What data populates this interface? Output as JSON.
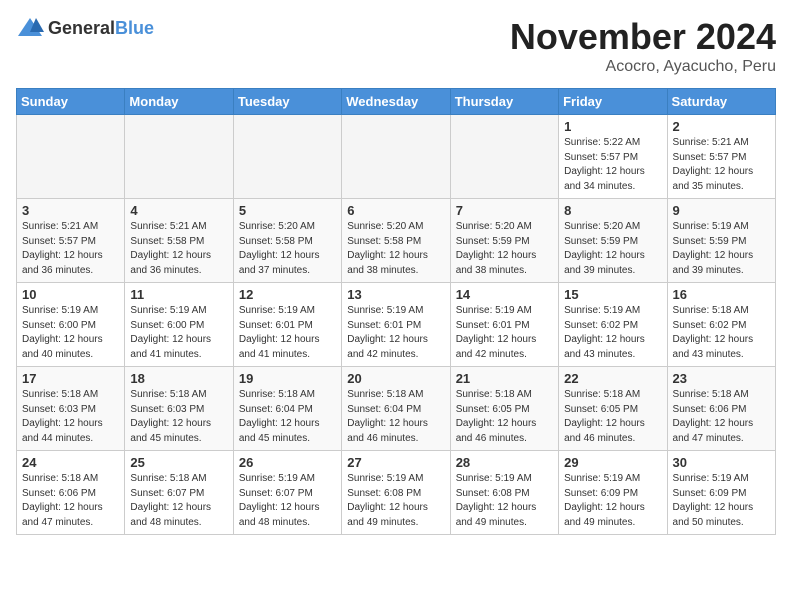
{
  "header": {
    "logo_general": "General",
    "logo_blue": "Blue",
    "month": "November 2024",
    "location": "Acocro, Ayacucho, Peru"
  },
  "weekdays": [
    "Sunday",
    "Monday",
    "Tuesday",
    "Wednesday",
    "Thursday",
    "Friday",
    "Saturday"
  ],
  "weeks": [
    [
      {
        "num": "",
        "info": ""
      },
      {
        "num": "",
        "info": ""
      },
      {
        "num": "",
        "info": ""
      },
      {
        "num": "",
        "info": ""
      },
      {
        "num": "",
        "info": ""
      },
      {
        "num": "1",
        "info": "Sunrise: 5:22 AM\nSunset: 5:57 PM\nDaylight: 12 hours\nand 34 minutes."
      },
      {
        "num": "2",
        "info": "Sunrise: 5:21 AM\nSunset: 5:57 PM\nDaylight: 12 hours\nand 35 minutes."
      }
    ],
    [
      {
        "num": "3",
        "info": "Sunrise: 5:21 AM\nSunset: 5:57 PM\nDaylight: 12 hours\nand 36 minutes."
      },
      {
        "num": "4",
        "info": "Sunrise: 5:21 AM\nSunset: 5:58 PM\nDaylight: 12 hours\nand 36 minutes."
      },
      {
        "num": "5",
        "info": "Sunrise: 5:20 AM\nSunset: 5:58 PM\nDaylight: 12 hours\nand 37 minutes."
      },
      {
        "num": "6",
        "info": "Sunrise: 5:20 AM\nSunset: 5:58 PM\nDaylight: 12 hours\nand 38 minutes."
      },
      {
        "num": "7",
        "info": "Sunrise: 5:20 AM\nSunset: 5:59 PM\nDaylight: 12 hours\nand 38 minutes."
      },
      {
        "num": "8",
        "info": "Sunrise: 5:20 AM\nSunset: 5:59 PM\nDaylight: 12 hours\nand 39 minutes."
      },
      {
        "num": "9",
        "info": "Sunrise: 5:19 AM\nSunset: 5:59 PM\nDaylight: 12 hours\nand 39 minutes."
      }
    ],
    [
      {
        "num": "10",
        "info": "Sunrise: 5:19 AM\nSunset: 6:00 PM\nDaylight: 12 hours\nand 40 minutes."
      },
      {
        "num": "11",
        "info": "Sunrise: 5:19 AM\nSunset: 6:00 PM\nDaylight: 12 hours\nand 41 minutes."
      },
      {
        "num": "12",
        "info": "Sunrise: 5:19 AM\nSunset: 6:01 PM\nDaylight: 12 hours\nand 41 minutes."
      },
      {
        "num": "13",
        "info": "Sunrise: 5:19 AM\nSunset: 6:01 PM\nDaylight: 12 hours\nand 42 minutes."
      },
      {
        "num": "14",
        "info": "Sunrise: 5:19 AM\nSunset: 6:01 PM\nDaylight: 12 hours\nand 42 minutes."
      },
      {
        "num": "15",
        "info": "Sunrise: 5:19 AM\nSunset: 6:02 PM\nDaylight: 12 hours\nand 43 minutes."
      },
      {
        "num": "16",
        "info": "Sunrise: 5:18 AM\nSunset: 6:02 PM\nDaylight: 12 hours\nand 43 minutes."
      }
    ],
    [
      {
        "num": "17",
        "info": "Sunrise: 5:18 AM\nSunset: 6:03 PM\nDaylight: 12 hours\nand 44 minutes."
      },
      {
        "num": "18",
        "info": "Sunrise: 5:18 AM\nSunset: 6:03 PM\nDaylight: 12 hours\nand 45 minutes."
      },
      {
        "num": "19",
        "info": "Sunrise: 5:18 AM\nSunset: 6:04 PM\nDaylight: 12 hours\nand 45 minutes."
      },
      {
        "num": "20",
        "info": "Sunrise: 5:18 AM\nSunset: 6:04 PM\nDaylight: 12 hours\nand 46 minutes."
      },
      {
        "num": "21",
        "info": "Sunrise: 5:18 AM\nSunset: 6:05 PM\nDaylight: 12 hours\nand 46 minutes."
      },
      {
        "num": "22",
        "info": "Sunrise: 5:18 AM\nSunset: 6:05 PM\nDaylight: 12 hours\nand 46 minutes."
      },
      {
        "num": "23",
        "info": "Sunrise: 5:18 AM\nSunset: 6:06 PM\nDaylight: 12 hours\nand 47 minutes."
      }
    ],
    [
      {
        "num": "24",
        "info": "Sunrise: 5:18 AM\nSunset: 6:06 PM\nDaylight: 12 hours\nand 47 minutes."
      },
      {
        "num": "25",
        "info": "Sunrise: 5:18 AM\nSunset: 6:07 PM\nDaylight: 12 hours\nand 48 minutes."
      },
      {
        "num": "26",
        "info": "Sunrise: 5:19 AM\nSunset: 6:07 PM\nDaylight: 12 hours\nand 48 minutes."
      },
      {
        "num": "27",
        "info": "Sunrise: 5:19 AM\nSunset: 6:08 PM\nDaylight: 12 hours\nand 49 minutes."
      },
      {
        "num": "28",
        "info": "Sunrise: 5:19 AM\nSunset: 6:08 PM\nDaylight: 12 hours\nand 49 minutes."
      },
      {
        "num": "29",
        "info": "Sunrise: 5:19 AM\nSunset: 6:09 PM\nDaylight: 12 hours\nand 49 minutes."
      },
      {
        "num": "30",
        "info": "Sunrise: 5:19 AM\nSunset: 6:09 PM\nDaylight: 12 hours\nand 50 minutes."
      }
    ]
  ]
}
